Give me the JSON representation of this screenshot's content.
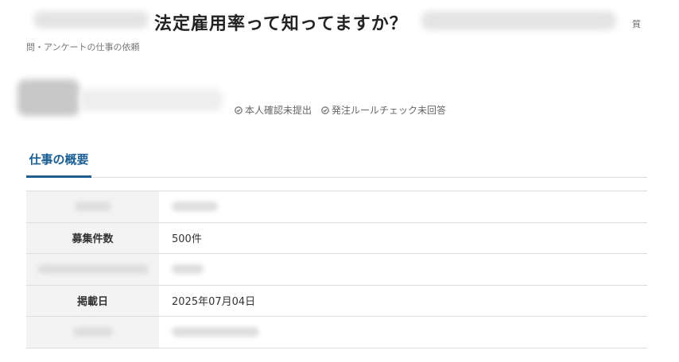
{
  "header": {
    "title": "法定雇用率って知ってますか？",
    "title_tail": "質",
    "breadcrumb": "問・アンケートの仕事の依頼"
  },
  "status_badges": [
    {
      "label": "本人確認未提出",
      "icon": "check-circle-icon"
    },
    {
      "label": "発注ルールチェック未回答",
      "icon": "check-circle-icon"
    }
  ],
  "tabs": [
    {
      "label": "仕事の概要",
      "active": true
    }
  ],
  "overview_table": {
    "rows": [
      {
        "label": "",
        "value": ""
      },
      {
        "label": "募集件数",
        "value": "500件"
      },
      {
        "label": "",
        "value": ""
      },
      {
        "label": "掲載日",
        "value": "2025年07月04日"
      },
      {
        "label": "",
        "value": ""
      }
    ]
  },
  "colors": {
    "accent": "#1a5e94",
    "table_header_bg": "#f3f3f3",
    "border": "#dddddd"
  }
}
